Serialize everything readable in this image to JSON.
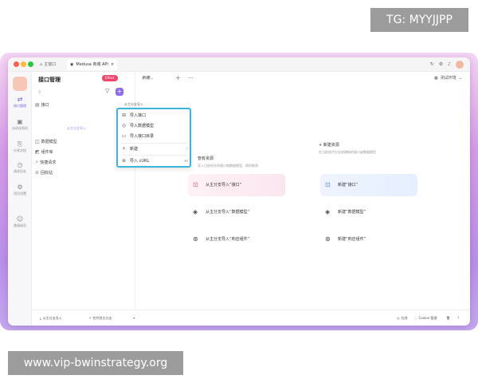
{
  "watermarks": {
    "top_right": "TG: MYYJJPP",
    "bottom_left": "www.vip-bwinstrategy.org"
  },
  "titlebar": {
    "home_tab": "主窗口",
    "active_tab": "Medusa 商城 API",
    "close_glyph": "×"
  },
  "left_nav": {
    "items": [
      {
        "label": "接口管理",
        "icon": "link-icon",
        "glyph": "⇄"
      },
      {
        "label": "自动化测试",
        "icon": "test-icon",
        "glyph": "▣"
      },
      {
        "label": "分享文档",
        "icon": "share-icon",
        "glyph": "⎘"
      },
      {
        "label": "请求历史",
        "icon": "history-icon",
        "glyph": "◷"
      },
      {
        "label": "项目设置",
        "icon": "settings-icon",
        "glyph": "⚙"
      },
      {
        "label": "邀请成员",
        "icon": "user-icon",
        "glyph": "☺"
      }
    ]
  },
  "tree": {
    "title": "接口管理",
    "search_placeholder": "",
    "items": [
      {
        "label": "接口",
        "glyph": "▤"
      },
      {
        "label": "数据模型",
        "glyph": "◫"
      },
      {
        "label": "组件库",
        "glyph": "◩"
      },
      {
        "label": "快捷请求",
        "glyph": "⚡"
      },
      {
        "label": "回收站",
        "glyph": "⊘"
      }
    ],
    "hint": "从主分支导入"
  },
  "header": {
    "request_pill": "Effect",
    "new_tab": "新建...",
    "env_label": "测试环境"
  },
  "import_label": "从主分支导入",
  "popup": {
    "items": [
      {
        "label": "导入接口",
        "glyph": "⊞"
      },
      {
        "label": "导入数据模型",
        "glyph": "◎"
      },
      {
        "label": "导入接口目录",
        "glyph": "▭"
      },
      {
        "label": "新建",
        "glyph": "+",
        "chevron": "›"
      },
      {
        "label": "导入 cURL",
        "glyph": "⊕",
        "shortcut": "⌘I"
      }
    ]
  },
  "sections": {
    "left": {
      "head": "管有资源",
      "desc": "导入已经存在的接口和数据模型、帮你推改",
      "items": [
        {
          "label": "从主分支导入“接口”",
          "glyph": "⊡"
        },
        {
          "label": "从主分支导入“数据模型”",
          "glyph": "◈"
        },
        {
          "label": "从主分支导入“响应组件”",
          "glyph": "⊛"
        }
      ]
    },
    "right": {
      "head": "+ 新建资源",
      "desc": "在当前迭代分支创建新的接口或数据模型",
      "items": [
        {
          "label": "新建“接口”",
          "glyph": "⊡"
        },
        {
          "label": "新建“数据模型”",
          "glyph": "◈"
        },
        {
          "label": "新建“响应组件”",
          "glyph": "⊛"
        }
      ]
    }
  },
  "bottombar": {
    "import_main": "从主分支导入",
    "merge_main": "合并到主分支",
    "online": "在线",
    "cookie": "Cookie 管理"
  },
  "colors": {
    "accent": "#8b6cf0",
    "popup_border": "#39b6d9",
    "pill": "#f2436b"
  }
}
